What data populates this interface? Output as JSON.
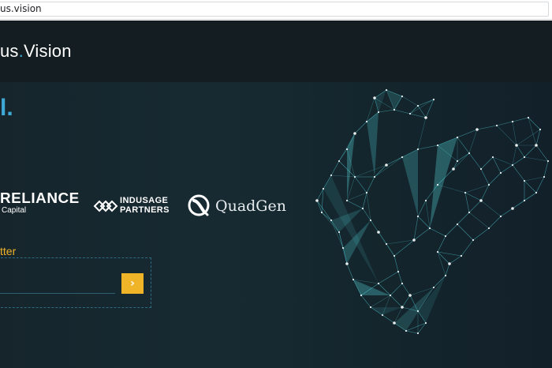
{
  "browser": {
    "url": "us.vision"
  },
  "header": {
    "logo_prefix": "us",
    "logo_dot": ".",
    "logo_suffix": "Vision"
  },
  "hero": {
    "heading_fragment": "l."
  },
  "partners": [
    {
      "name": "RELIANCE",
      "sub": "Capital"
    },
    {
      "line1": "INDUSAGE",
      "line2": "PARTNERS"
    },
    {
      "name": "QuadGen"
    }
  ],
  "newsletter": {
    "label": "tter",
    "email_value": "",
    "submit_glyph": "›"
  },
  "colors": {
    "accent_blue": "#3fa9d6",
    "accent_yellow": "#f0b429",
    "background": "#152027",
    "map_cyan": "#56d4dc"
  },
  "icons": {
    "submit": "chevron-right-icon",
    "indusage": "diamond-chain-logo-icon",
    "quadgen": "q-swirl-logo-icon",
    "map": "polygon-network-world-map"
  }
}
